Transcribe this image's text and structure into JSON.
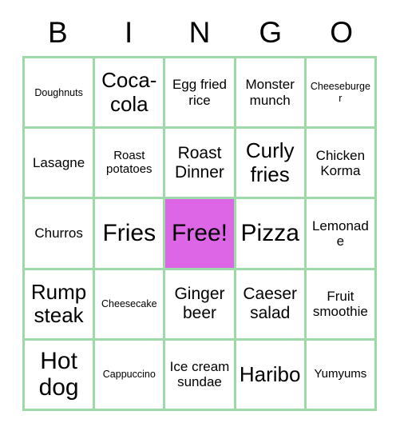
{
  "card": {
    "title": "BINGO",
    "header_letters": [
      "B",
      "I",
      "N",
      "G",
      "O"
    ],
    "grid_size": "5x5",
    "colors": {
      "border": "#9ED9A8",
      "free_space_fill": "#DD66E6",
      "background": "#FFFFFF",
      "text": "#000000"
    },
    "cells": [
      {
        "label": "Doughnuts",
        "column": "B",
        "row": 1,
        "size": "xs",
        "marked": false
      },
      {
        "label": "Coca-cola",
        "column": "I",
        "row": 1,
        "size": "xl",
        "marked": false
      },
      {
        "label": "Egg fried rice",
        "column": "N",
        "row": 1,
        "size": "m",
        "marked": false
      },
      {
        "label": "Monster munch",
        "column": "G",
        "row": 1,
        "size": "m",
        "marked": false
      },
      {
        "label": "Cheeseburger",
        "column": "O",
        "row": 1,
        "size": "xs",
        "marked": false
      },
      {
        "label": "Lasagne",
        "column": "B",
        "row": 2,
        "size": "m",
        "marked": false
      },
      {
        "label": "Roast potatoes",
        "column": "I",
        "row": 2,
        "size": "s",
        "marked": false
      },
      {
        "label": "Roast Dinner",
        "column": "N",
        "row": 2,
        "size": "l",
        "marked": false
      },
      {
        "label": "Curly fries",
        "column": "G",
        "row": 2,
        "size": "xl",
        "marked": false
      },
      {
        "label": "Chicken Korma",
        "column": "O",
        "row": 2,
        "size": "m",
        "marked": false
      },
      {
        "label": "Churros",
        "column": "B",
        "row": 3,
        "size": "m",
        "marked": false
      },
      {
        "label": "Fries",
        "column": "I",
        "row": 3,
        "size": "xxl",
        "marked": false
      },
      {
        "label": "Free!",
        "column": "N",
        "row": 3,
        "size": "xxl",
        "marked": true
      },
      {
        "label": "Pizza",
        "column": "G",
        "row": 3,
        "size": "xxl",
        "marked": false
      },
      {
        "label": "Lemonade",
        "column": "O",
        "row": 3,
        "size": "m",
        "marked": false
      },
      {
        "label": "Rump steak",
        "column": "B",
        "row": 4,
        "size": "xl",
        "marked": false
      },
      {
        "label": "Cheesecake",
        "column": "I",
        "row": 4,
        "size": "xs",
        "marked": false
      },
      {
        "label": "Ginger beer",
        "column": "N",
        "row": 4,
        "size": "l",
        "marked": false
      },
      {
        "label": "Caeser salad",
        "column": "G",
        "row": 4,
        "size": "l",
        "marked": false
      },
      {
        "label": "Fruit smoothie",
        "column": "O",
        "row": 4,
        "size": "m",
        "marked": false
      },
      {
        "label": "Hot dog",
        "column": "B",
        "row": 5,
        "size": "xxl",
        "marked": false
      },
      {
        "label": "Cappuccino",
        "column": "I",
        "row": 5,
        "size": "xs",
        "marked": false
      },
      {
        "label": "Ice cream sundae",
        "column": "N",
        "row": 5,
        "size": "m",
        "marked": false
      },
      {
        "label": "Haribo",
        "column": "G",
        "row": 5,
        "size": "xl",
        "marked": false
      },
      {
        "label": "Yumyums",
        "column": "O",
        "row": 5,
        "size": "s",
        "marked": false
      }
    ]
  }
}
